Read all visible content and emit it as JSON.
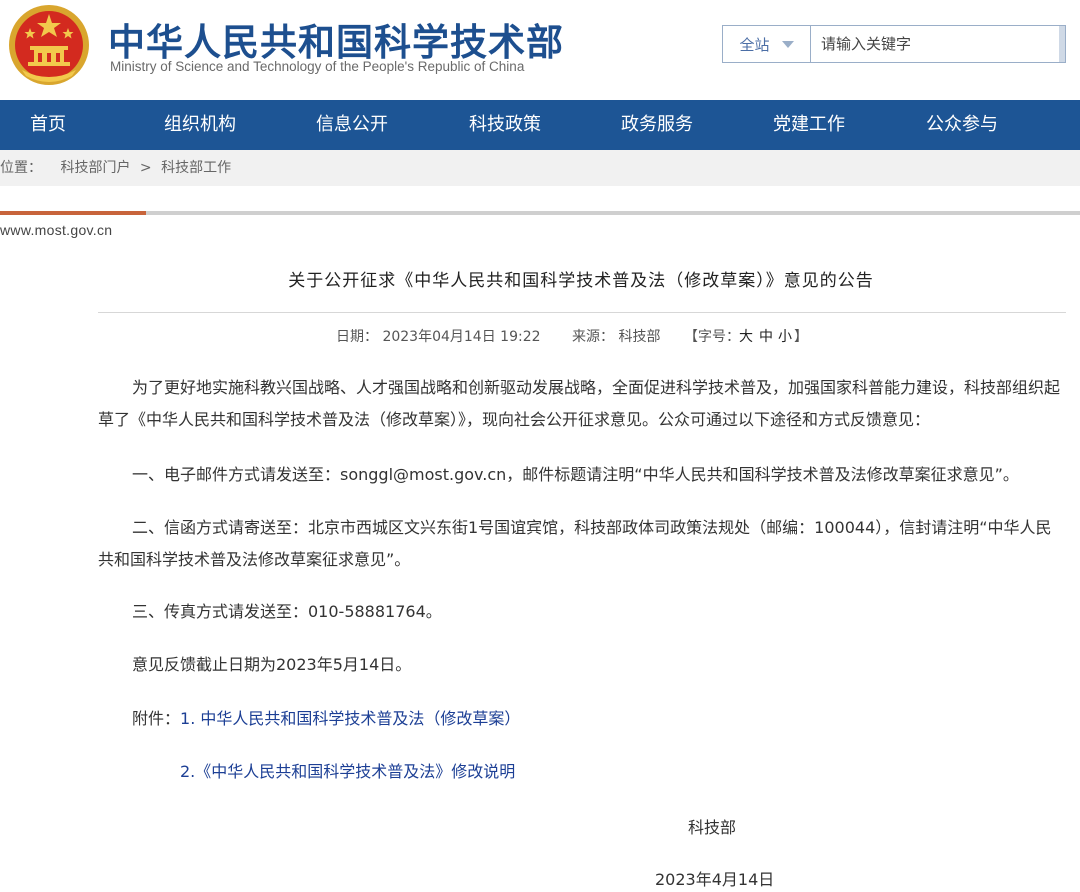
{
  "header": {
    "title": "中华人民共和国科学技术部",
    "subtitle": "Ministry of Science and Technology of the People's Republic of China"
  },
  "search": {
    "scope": "全站",
    "placeholder": "请输入关键字"
  },
  "nav": [
    "首页",
    "组织机构",
    "信息公开",
    "科技政策",
    "政务服务",
    "党建工作",
    "公众参与"
  ],
  "breadcrumb": {
    "prefix": "位置：",
    "items": [
      "科技部门户",
      "科技部工作"
    ],
    "separator": ">"
  },
  "domain": "www.most.gov.cn",
  "article": {
    "title": "关于公开征求《中华人民共和国科学技术普及法（修改草案）》意见的公告",
    "meta": {
      "date": "日期：  2023年04月14日    19:22",
      "source": "来源：  科技部",
      "fontsize_label": "【字号：",
      "fontsize_large": "大",
      "fontsize_medium": "中",
      "fontsize_small": "小",
      "fontsize_end": "】"
    },
    "intro": "为了更好地实施科教兴国战略、人才强国战略和创新驱动发展战略，全面促进科学技术普及，加强国家科普能力建设，科技部组织起草了《中华人民共和国科学技术普及法（修改草案）》，现向社会公开征求意见。公众可通过以下途径和方式反馈意见：",
    "item1": "一、电子邮件方式请发送至：songgl@most.gov.cn，邮件标题请注明“中华人民共和国科学技术普及法修改草案征求意见”。",
    "item2": "二、信函方式请寄送至：北京市西城区文兴东街1号国谊宾馆，科技部政体司政策法规处（邮编：100044），信封请注明“中华人民共和国科学技术普及法修改草案征求意见”。",
    "item3": "三、传真方式请发送至：010-58881764。",
    "deadline": "意见反馈截止日期为2023年5月14日。",
    "attachments_label": "附件：",
    "attachments": [
      "1. 中华人民共和国科学技术普及法（修改草案）",
      "2.《中华人民共和国科学技术普及法》修改说明"
    ],
    "signature": "科技部",
    "sign_date": "2023年4月14日"
  },
  "colors": {
    "nav_bg": "#1d5595",
    "title_blue": "#1d4f8f",
    "accent": "#c8643b",
    "link": "#1c3f95"
  }
}
